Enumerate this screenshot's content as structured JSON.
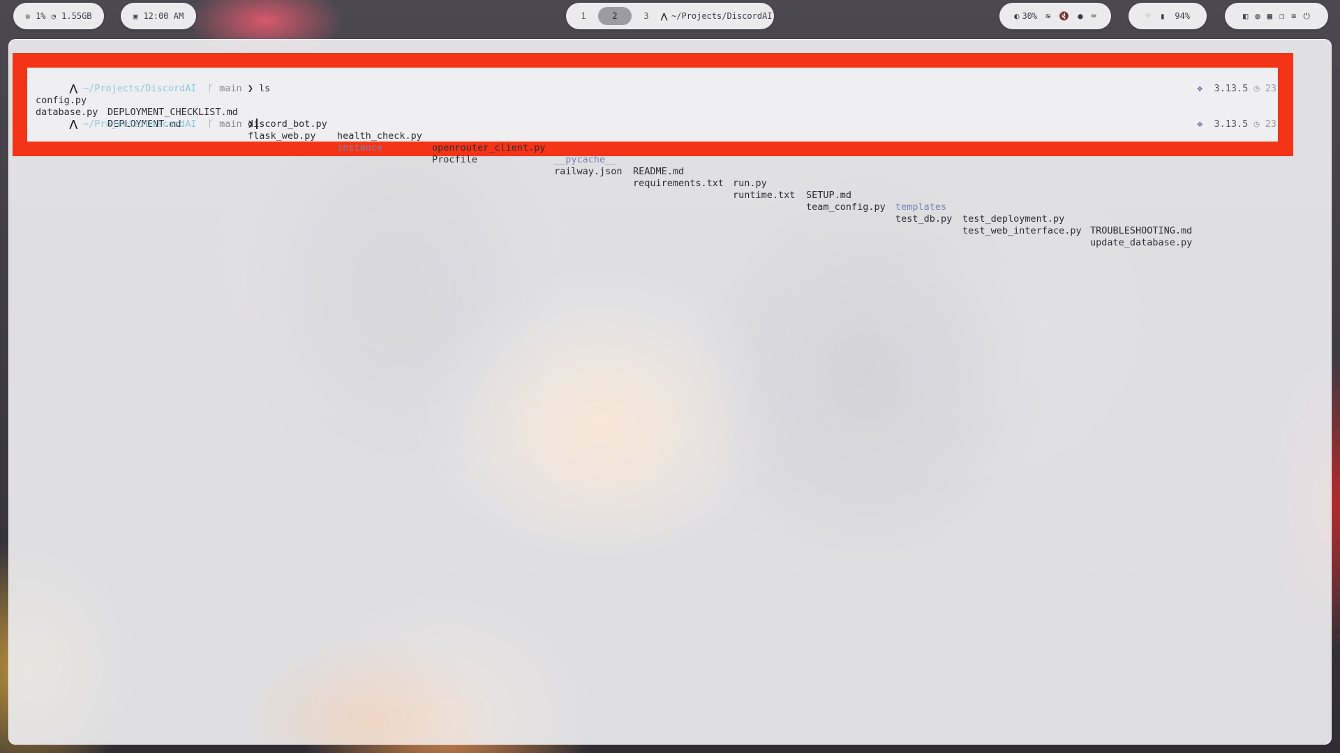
{
  "topbar": {
    "system": {
      "cpu": "1%",
      "memory": "1.55GB"
    },
    "clock": {
      "time": "12:00 AM"
    },
    "workspaces": [
      {
        "label": "1"
      },
      {
        "label": "2",
        "active": true
      },
      {
        "label": "3"
      }
    ],
    "active_window_title": "~/Projects/DiscordAI",
    "status": {
      "brightness": "30%"
    },
    "battery": {
      "level": "94%"
    }
  },
  "terminal": {
    "prompt_path": "~/Projects/DiscordAI",
    "branch": "main",
    "command": "ls",
    "python_version": "3.13.5",
    "right_time": "23",
    "ls_output": {
      "row1": [
        "config.py",
        "DEPLOYMENT_CHECKLIST.md",
        "discord_bot.py",
        "health_check.py",
        "openrouter_client.py",
        "__pycache__",
        "README.md",
        "run.py",
        "SETUP.md",
        "templates",
        "test_deployment.py",
        "TROUBLESHOOTING.md"
      ],
      "row2": [
        "database.py",
        "DEPLOYMENT.md",
        "flask_web.py",
        "instance",
        "Procfile",
        "railway.json",
        "requirements.txt",
        "runtime.txt",
        "team_config.py",
        "test_db.py",
        "test_web_interface.py",
        "update_database.py"
      ]
    },
    "directory_names": [
      "__pycache__",
      "templates",
      "instance"
    ]
  },
  "colors": {
    "highlight": "#f43416",
    "path": "#8cc8de",
    "directory": "#7a82b8",
    "terminal_bg": "#efeff1"
  }
}
